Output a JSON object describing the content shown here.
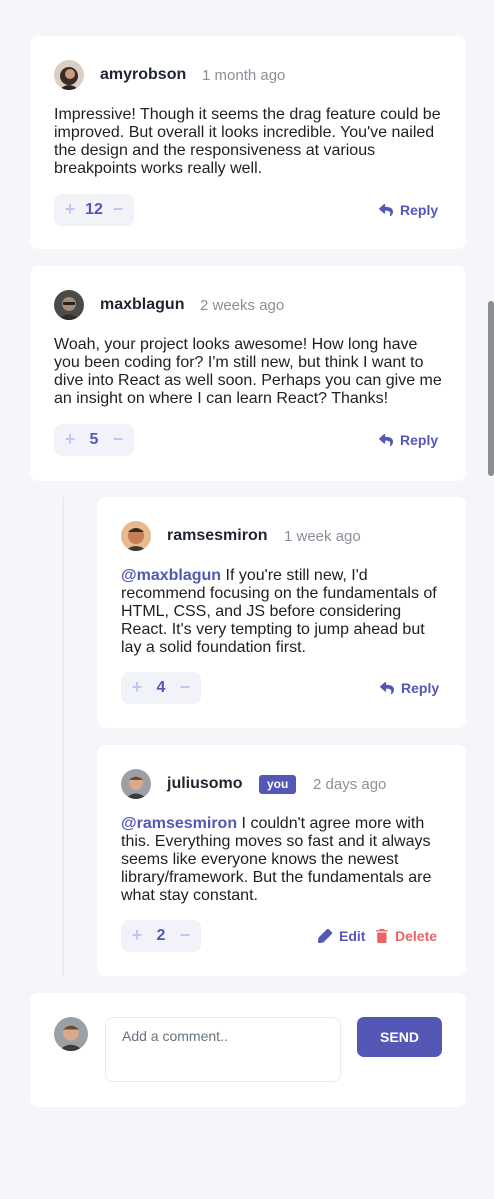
{
  "comments": [
    {
      "username": "amyrobson",
      "date": "1 month ago",
      "content": "Impressive! Though it seems the drag feature could be improved. But overall it looks incredible. You've nailed the design and the responsiveness at various breakpoints works really well.",
      "score": "12",
      "reply_label": "Reply"
    },
    {
      "username": "maxblagun",
      "date": "2 weeks ago",
      "content": "Woah, your project looks awesome! How long have you been coding for? I'm still new, but think I want to dive into React as well soon. Perhaps you can give me an insight on where I can learn React? Thanks!",
      "score": "5",
      "reply_label": "Reply"
    }
  ],
  "replies": [
    {
      "username": "ramsesmiron",
      "date": "1 week ago",
      "mention": "@maxblagun",
      "content": "If you're still new, I'd recommend focusing on the fundamentals of HTML, CSS, and JS before considering React. It's very tempting to jump ahead but lay a solid foundation first.",
      "score": "4",
      "reply_label": "Reply"
    },
    {
      "username": "juliusomo",
      "you_badge": "you",
      "date": "2 days ago",
      "mention": "@ramsesmiron",
      "content": "I couldn't agree more with this. Everything moves so fast and it always seems like everyone knows the newest library/framework. But the fundamentals are what stay constant.",
      "score": "2",
      "edit_label": "Edit",
      "delete_label": "Delete"
    }
  ],
  "new_comment": {
    "placeholder": "Add a comment..",
    "send_label": "SEND"
  },
  "icons": {
    "plus": "plus-icon",
    "minus": "minus-icon",
    "reply": "reply-icon",
    "edit": "edit-icon",
    "delete": "delete-icon"
  },
  "colors": {
    "accent": "#5457b6",
    "accent_light": "#c3c4ef",
    "danger": "#ed6468",
    "background": "#f5f6fa",
    "card": "#ffffff"
  }
}
